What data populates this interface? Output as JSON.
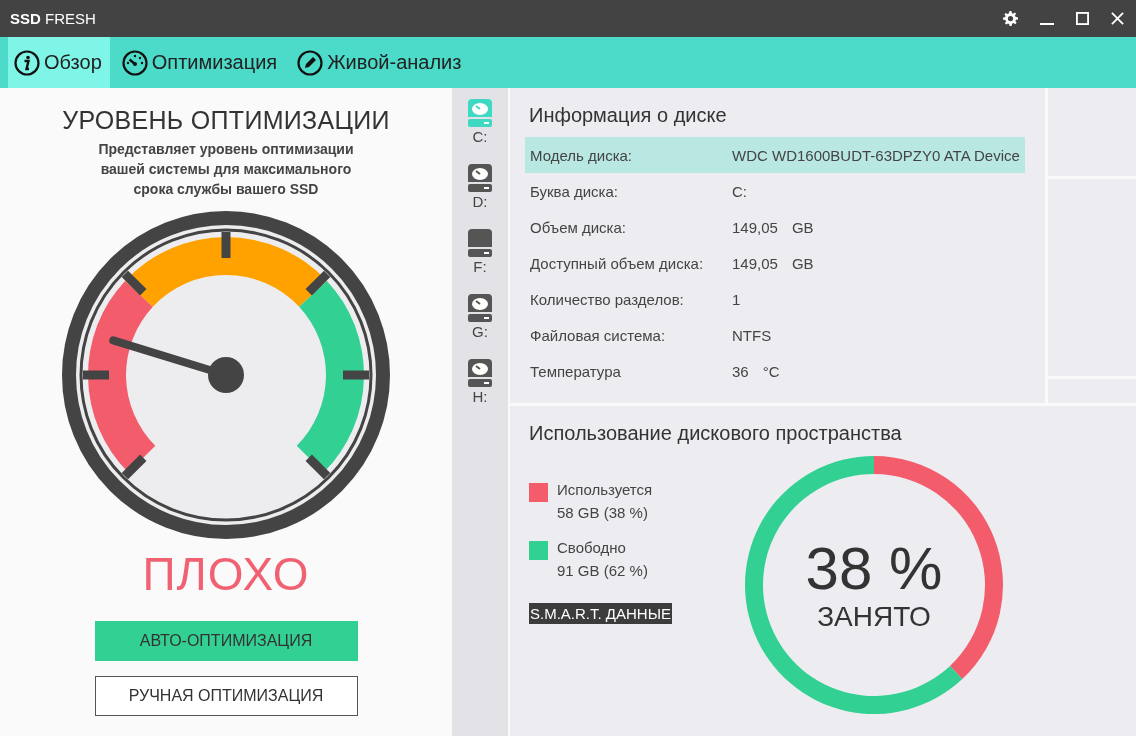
{
  "window": {
    "title_bold": "SSD",
    "title": "FRESH"
  },
  "tabs": [
    {
      "label": "Обзор",
      "selected": true
    },
    {
      "label": "Оптимизация",
      "selected": false
    },
    {
      "label": "Живой-анализ",
      "selected": false
    }
  ],
  "optimization": {
    "title": "УРОВЕНЬ ОПТИМИЗАЦИИ",
    "description": "Представляет уровень оптимизации вашей системы для максимального срока службы вашего SSD",
    "level": 0.23,
    "status": "ПЛОХО",
    "buttons": [
      {
        "label": "АВТО-ОПТИМИЗАЦИЯ",
        "kind": "primary"
      },
      {
        "label": "РУЧНАЯ ОПТИМИЗАЦИЯ",
        "kind": "secondary"
      }
    ]
  },
  "drives": [
    {
      "label": "C:",
      "kind": "disk",
      "selected": true
    },
    {
      "label": "D:",
      "kind": "disk",
      "selected": false
    },
    {
      "label": "F:",
      "kind": "plain",
      "selected": false
    },
    {
      "label": "G:",
      "kind": "disk",
      "selected": false
    },
    {
      "label": "H:",
      "kind": "disk",
      "selected": false
    }
  ],
  "disk_info": {
    "title": "Информация о диске",
    "rows": [
      {
        "label": "Модель диска:",
        "value": "WDC WD1600BUDT-63DPZY0 ATA Device",
        "selected": true
      },
      {
        "label": "Буква диска:",
        "value": "C:",
        "selected": false
      },
      {
        "label": "Объем диска:",
        "value": "149,05",
        "unit": "GB",
        "selected": false
      },
      {
        "label": "Доступный объем диска:",
        "value": "149,05",
        "unit": "GB",
        "selected": false
      },
      {
        "label": "Количество разделов:",
        "value": "1",
        "selected": false
      },
      {
        "label": "Файловая система:",
        "value": "NTFS",
        "selected": false
      },
      {
        "label": "Температура",
        "value": "36",
        "unit": "°C",
        "selected": false
      }
    ]
  },
  "disk_usage": {
    "title": "Использование дискового пространства",
    "legend": [
      {
        "detail": "58 GB (38 %)",
        "color": "#f25c6b"
      },
      {
        "detail": "91 GB (62 %)",
        "color": "#33d093"
      }
    ],
    "smart_button": "S.M.A.R.T. ДАННЫЕ",
    "center_value": "38 %",
    "center_label": "ЗАНЯТО",
    "chart_data": {
      "type": "donut",
      "categories": [
        "Используется",
        "Свободно"
      ],
      "values": [
        38,
        62
      ]
    }
  }
}
